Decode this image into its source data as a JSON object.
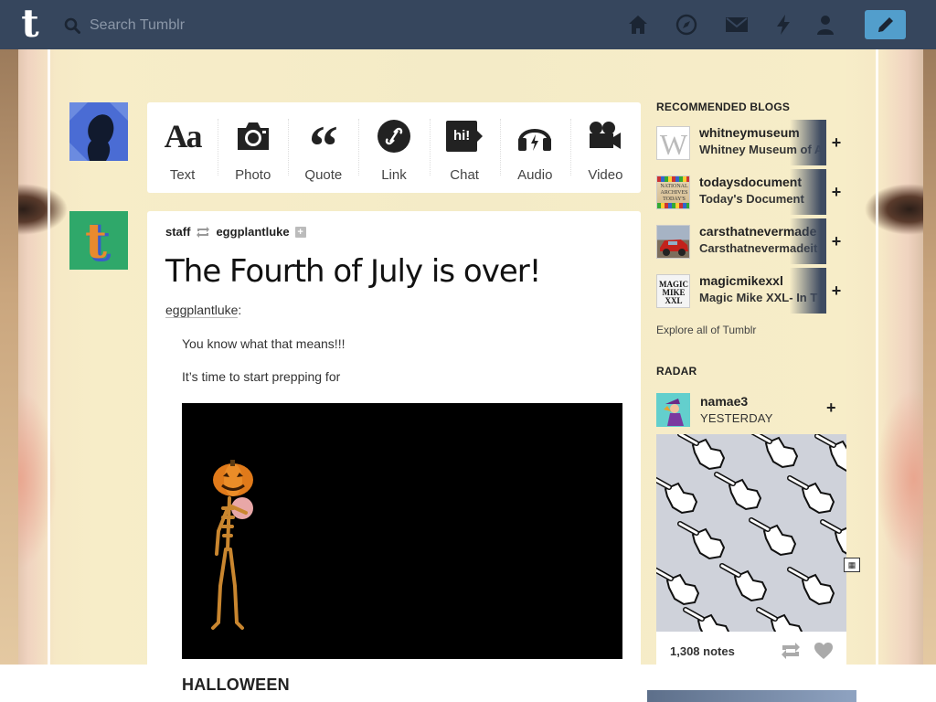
{
  "header": {
    "search_placeholder": "Search Tumblr",
    "icons": [
      "home-icon",
      "explore-icon",
      "mail-icon",
      "activity-icon",
      "account-icon",
      "compose-icon"
    ],
    "colors": {
      "bar": "#36465d",
      "compose": "#529ecc"
    }
  },
  "post_types": [
    {
      "label": "Text",
      "icon": "text-icon"
    },
    {
      "label": "Photo",
      "icon": "photo-icon"
    },
    {
      "label": "Quote",
      "icon": "quote-icon"
    },
    {
      "label": "Link",
      "icon": "link-icon"
    },
    {
      "label": "Chat",
      "icon": "chat-icon",
      "glyph": "hi!"
    },
    {
      "label": "Audio",
      "icon": "audio-icon"
    },
    {
      "label": "Video",
      "icon": "video-icon"
    }
  ],
  "post": {
    "author": "staff",
    "reblogged_from": "eggplantluke",
    "title": "The Fourth of July is over!",
    "source_user": "eggplantluke",
    "source_colon": ":",
    "line1": "You know what that means!!!",
    "line2": "It’s time to start prepping for",
    "heading": "HALLOWEEN"
  },
  "sidebar": {
    "recommended_heading": "RECOMMENDED BLOGS",
    "recommended": [
      {
        "name": "whitneymuseum",
        "title": "Whitney Museum of A"
      },
      {
        "name": "todaysdocument",
        "title": "Today's Document",
        "thumb_text": "NATIONAL ARCHIVES TODAY'S DOCUMENT"
      },
      {
        "name": "carsthatnevermade",
        "title": "Carsthatnevermadeit"
      },
      {
        "name": "magicmikexxl",
        "title": "Magic Mike XXL- In T",
        "thumb_text": "MAGIC MIKE XXL"
      }
    ],
    "add_label": "+",
    "explore_link": "Explore all of Tumblr",
    "radar_heading": "RADAR",
    "radar": {
      "user": "namae3",
      "time": "YESTERDAY",
      "follow_label": "+",
      "notes": "1,308 notes"
    }
  }
}
